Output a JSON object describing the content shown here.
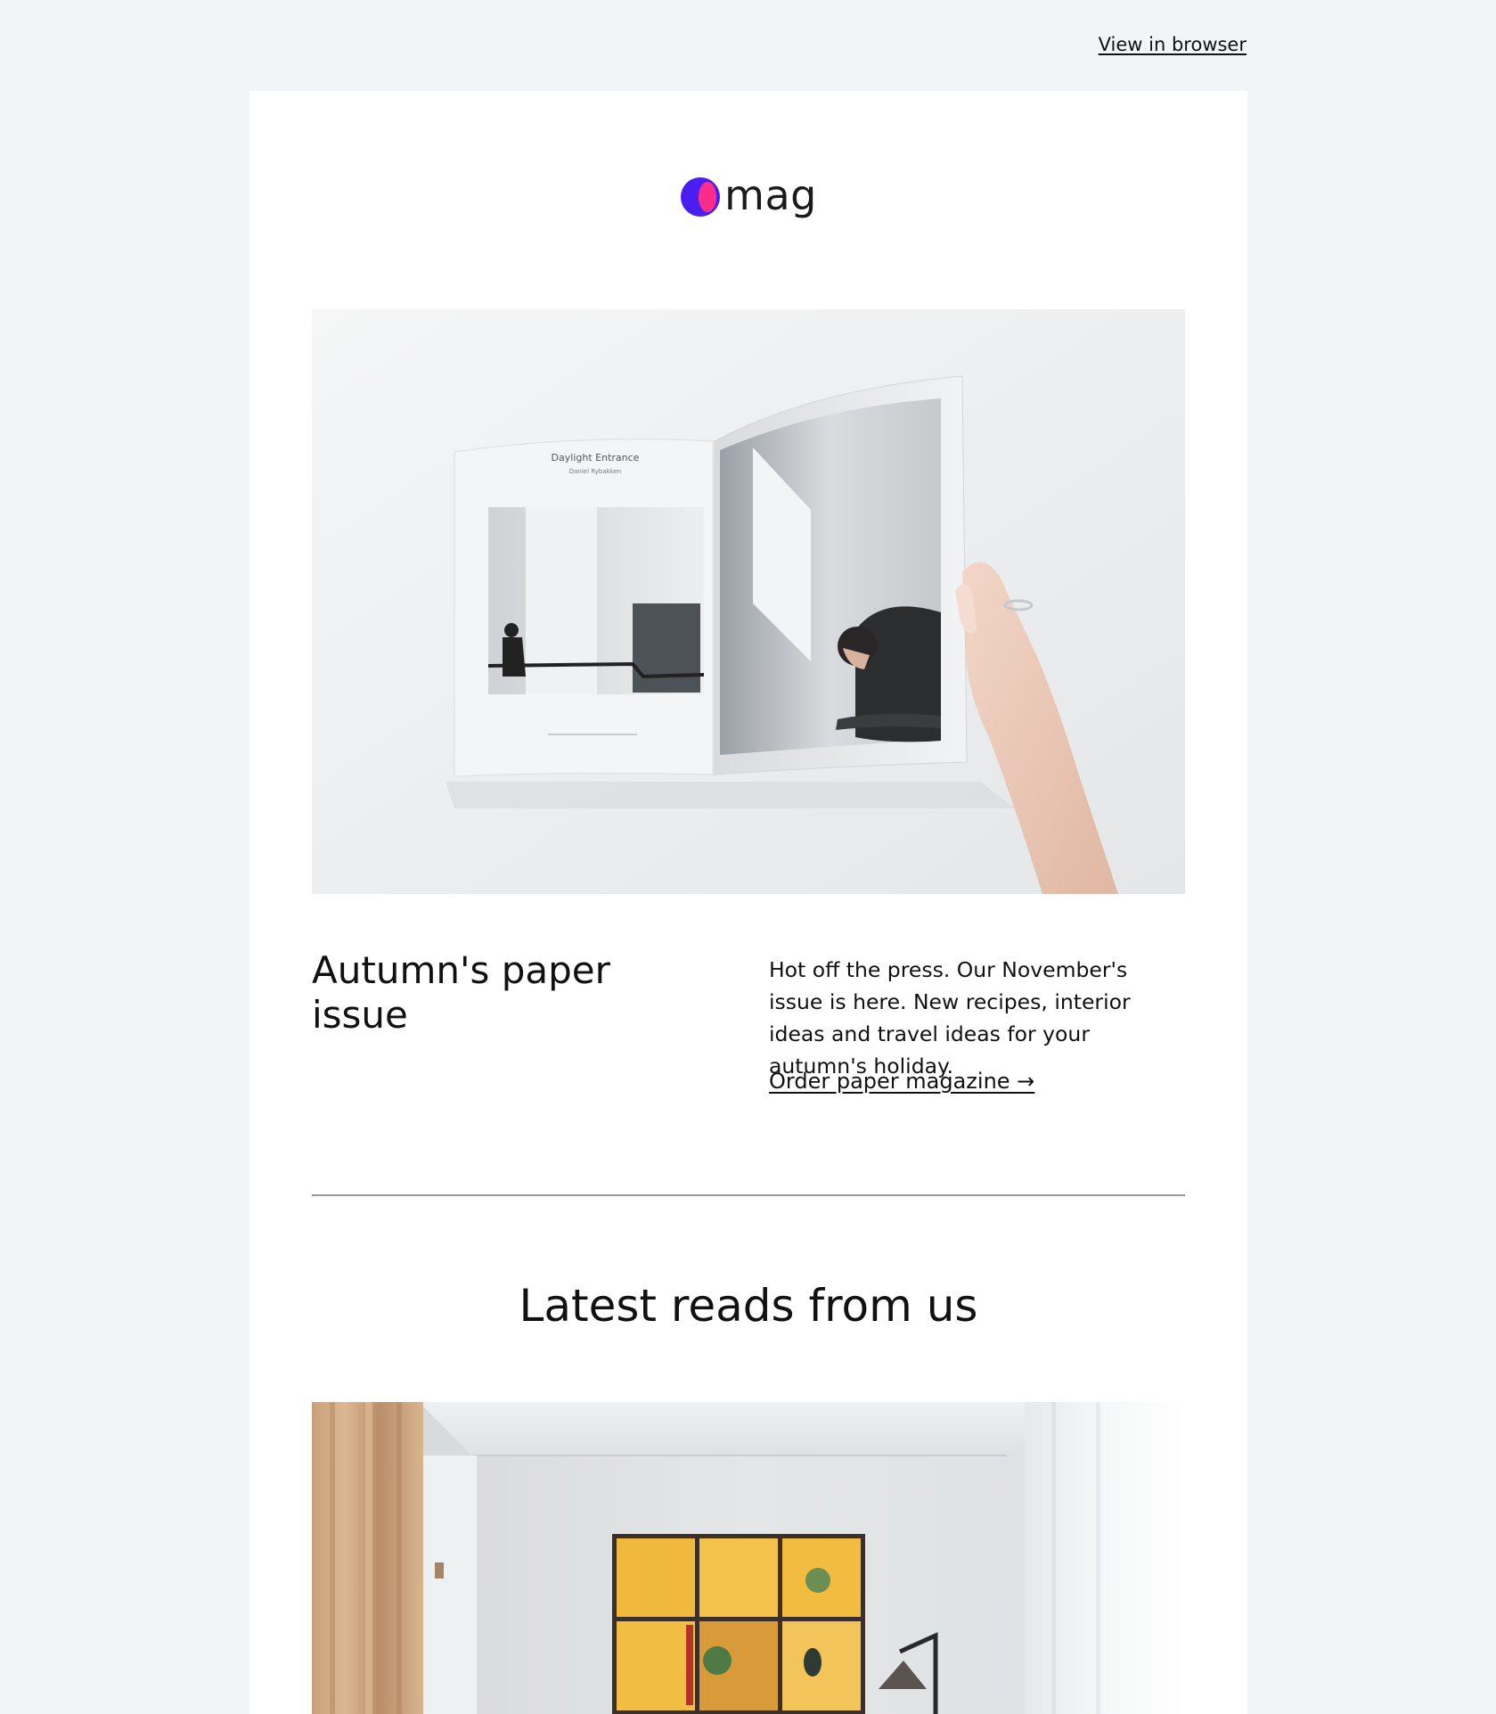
{
  "header": {
    "view_in_browser": "View in browser"
  },
  "logo": {
    "text": "mag",
    "icon": "logo-mark-icon",
    "colors": {
      "primary": "#4a1df0",
      "secondary": "#ff2d8a"
    }
  },
  "hero": {
    "image": "open-magazine-photo",
    "book_left_page_title": "Daylight Entrance",
    "book_left_page_author": "Daniel Rybakken"
  },
  "feature": {
    "title": "Autumn's paper issue",
    "description": "Hot off the press. Our November's issue is here. New recipes, interior ideas and travel ideas for your autumn's holiday.",
    "link_label": "Order paper magazine →"
  },
  "latest": {
    "title": "Latest reads from us",
    "image": "interior-room-photo"
  },
  "colors": {
    "page_bg": "#f3f4f6",
    "card_bg": "#ffffff",
    "text": "#111111",
    "divider": "#9a9a9a"
  }
}
